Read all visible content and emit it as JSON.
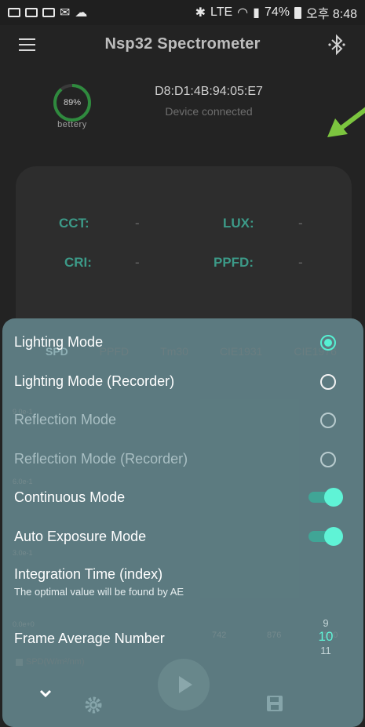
{
  "status": {
    "left_icons": [
      "notification-icon",
      "mail-icon",
      "mail-icon",
      "gmail-icon",
      "cloud-icon"
    ],
    "network": "LTE",
    "battery": "74%",
    "time": "오후 8:48"
  },
  "header": {
    "title": "Nsp32 Spectrometer"
  },
  "device": {
    "battery_percent": "89%",
    "battery_level": 0.89,
    "battery_label": "bettery",
    "mac": "D8:D1:4B:94:05:E7",
    "status": "Device connected"
  },
  "metrics": {
    "cct_label": "CCT:",
    "cct_value": "-",
    "lux_label": "LUX:",
    "lux_value": "-",
    "cri_label": "CRI:",
    "cri_value": "-",
    "ppfd_label": "PPFD:",
    "ppfd_value": "-"
  },
  "chart_bg": {
    "tabs": [
      "SPD",
      "PPFD",
      "Tm30",
      "CIE1931",
      "CIE1976"
    ],
    "y_ticks": [
      "9.0e-1",
      "6.0e-1",
      "3.0e-1",
      "0.0e+0"
    ],
    "x_ticks": [
      "742",
      "876",
      "100"
    ],
    "legend": "SPD(W/m²/nm)"
  },
  "sheet": {
    "options": [
      {
        "label": "Lighting Mode",
        "selected": true,
        "enabled": true
      },
      {
        "label": "Lighting Mode (Recorder)",
        "selected": false,
        "enabled": true
      },
      {
        "label": "Reflection Mode",
        "selected": false,
        "enabled": false
      },
      {
        "label": "Reflection Mode (Recorder)",
        "selected": false,
        "enabled": false
      }
    ],
    "continuous_label": "Continuous Mode",
    "continuous_on": true,
    "auto_exposure_label": "Auto Exposure Mode",
    "auto_exposure_on": true,
    "integration_label": "Integration Time (index)",
    "integration_sub": "The optimal value will be found by AE",
    "frame_label": "Frame Average Number",
    "frame_prev": "9",
    "frame_value": "10",
    "frame_next": "11"
  },
  "colors": {
    "accent": "#56F0D2",
    "sheet": "#608086",
    "label": "#3C9A88"
  }
}
